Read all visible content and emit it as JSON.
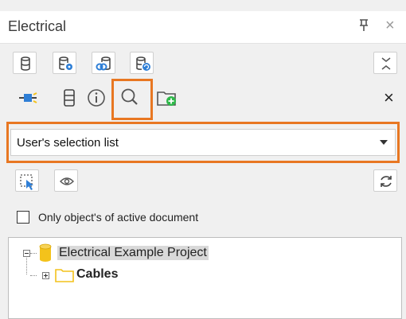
{
  "panel": {
    "title": "Electrical"
  },
  "toolbar_top": {
    "icons": [
      "database-icon",
      "database-settings-icon",
      "database-link-icon",
      "database-refresh-icon",
      "collapse-icon"
    ]
  },
  "tabs": {
    "icons": [
      "connector-tab-icon",
      "database-tab-icon",
      "info-tab-icon",
      "search-tab-icon",
      "add-folder-tab-icon"
    ],
    "active": "search-tab-icon"
  },
  "selection": {
    "value": "User's selection list"
  },
  "filter": {
    "checkbox_label": "Only object's of active document",
    "checked": false
  },
  "tree": {
    "root_label": "Electrical Example Project",
    "child_label": "Cables"
  },
  "colors": {
    "highlight": "#e87722",
    "accent_blue": "#2f7fd6",
    "accent_green": "#2fb84a",
    "folder_yellow": "#f3c21b"
  }
}
